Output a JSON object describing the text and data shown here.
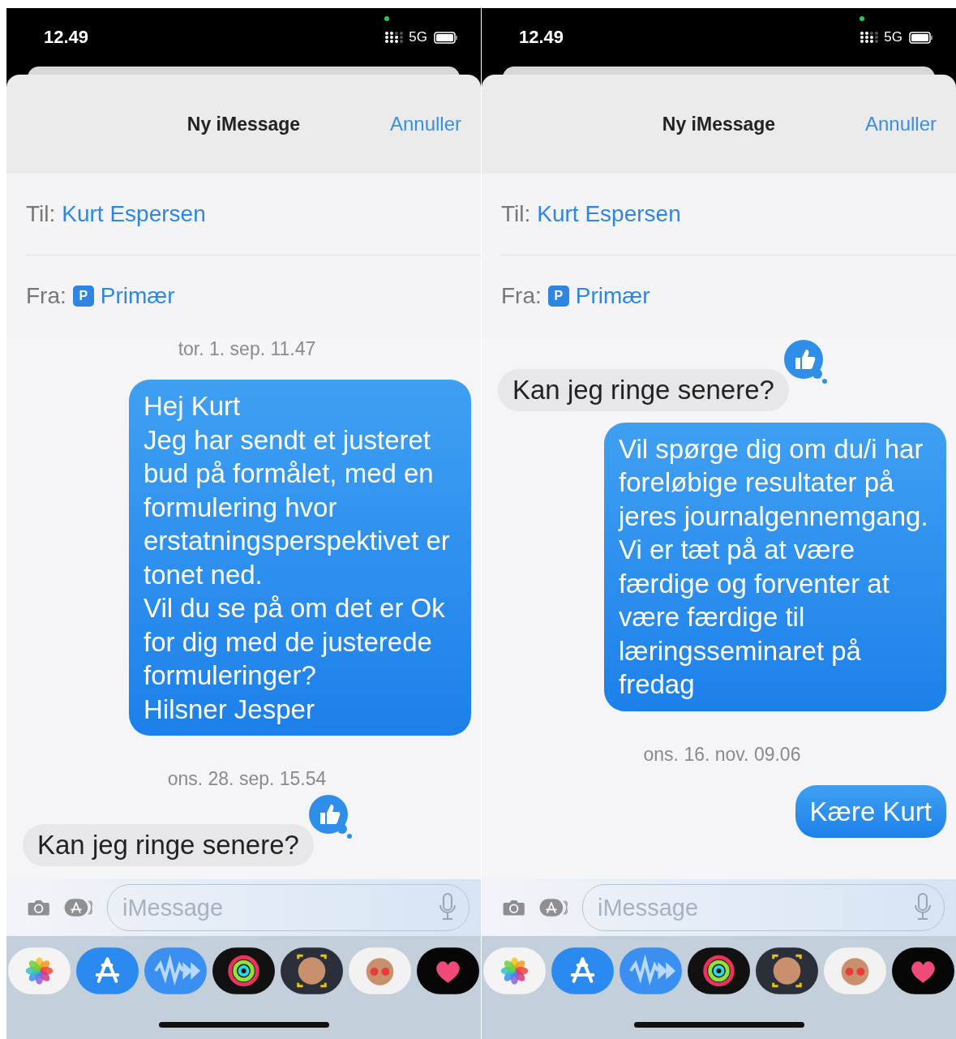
{
  "phones": [
    {
      "status_bar": {
        "time": "12.49",
        "network": "5G"
      },
      "header": {
        "title": "Ny iMessage",
        "cancel": "Annuller"
      },
      "to": {
        "label": "Til:",
        "value": "Kurt Espersen"
      },
      "from": {
        "label": "Fra:",
        "badge": "P",
        "value": "Primær"
      },
      "messages": [
        {
          "kind": "timestamp",
          "text": "tor. 1. sep. 11.47"
        },
        {
          "kind": "outgoing",
          "liked": false,
          "text": "Hej Kurt\nJeg har sendt et justeret bud på formålet, med en formulering hvor erstatningsperspektivet er tonet ned.\nVil du se på om det er Ok for dig med de justerede formuleringer?\nHilsner Jesper"
        },
        {
          "kind": "timestamp",
          "text": "ons. 28. sep. 15.54"
        },
        {
          "kind": "incoming",
          "liked": true,
          "text": "Kan jeg ringe senere?"
        }
      ],
      "compose": {
        "placeholder": "iMessage"
      }
    },
    {
      "status_bar": {
        "time": "12.49",
        "network": "5G"
      },
      "header": {
        "title": "Ny iMessage",
        "cancel": "Annuller"
      },
      "to": {
        "label": "Til:",
        "value": "Kurt Espersen"
      },
      "from": {
        "label": "Fra:",
        "badge": "P",
        "value": "Primær"
      },
      "messages": [
        {
          "kind": "incoming",
          "liked": true,
          "text": "Kan jeg ringe senere?"
        },
        {
          "kind": "outgoing",
          "liked": false,
          "text": "Vil spørge dig om du/i har foreløbige resultater på jeres journalgennemgang. Vi er tæt på at være færdige og forventer at være færdige til læringsseminaret på fredag"
        },
        {
          "kind": "timestamp",
          "text": "ons. 16. nov. 09.06"
        },
        {
          "kind": "outgoing",
          "liked": false,
          "text": "Kære Kurt"
        }
      ],
      "compose": {
        "placeholder": "iMessage"
      }
    }
  ]
}
